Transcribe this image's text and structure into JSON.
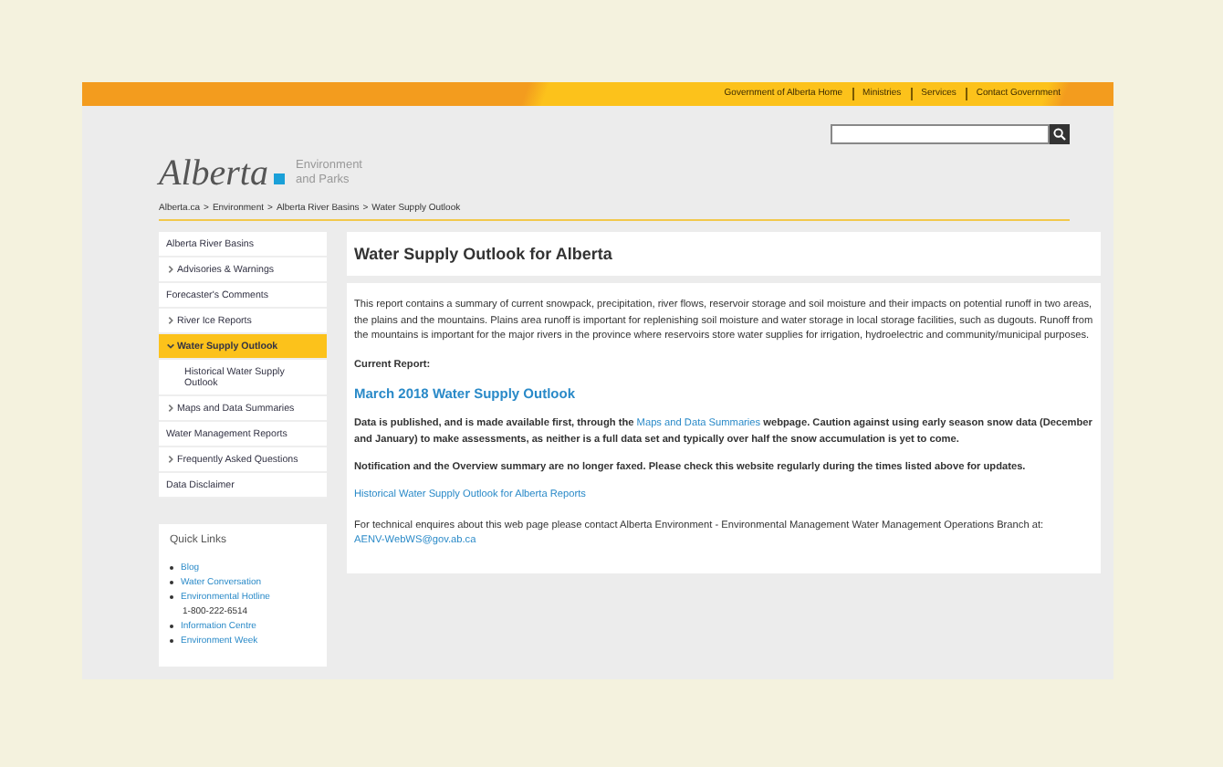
{
  "top_nav": [
    "Government of Alberta Home",
    "Ministries",
    "Services",
    "Contact Government"
  ],
  "logo": {
    "wordmark": "Alberta",
    "department": [
      "Environment",
      "and Parks"
    ]
  },
  "breadcrumb": {
    "separator": ">",
    "items": [
      "Alberta.ca",
      "Environment",
      "Alberta River Basins",
      "Water Supply Outlook"
    ]
  },
  "sidebar": {
    "items": [
      {
        "label": "Alberta River Basins",
        "kind": "plain",
        "selected": false
      },
      {
        "label": "Advisories & Warnings",
        "kind": "toggle",
        "expanded": false,
        "selected": false
      },
      {
        "label": "Forecaster's Comments",
        "kind": "plain",
        "selected": false
      },
      {
        "label": "River Ice Reports",
        "kind": "toggle",
        "expanded": false,
        "selected": false
      },
      {
        "label": "Water Supply Outlook",
        "kind": "toggle",
        "expanded": true,
        "selected": true,
        "children": [
          {
            "label": "Historical Water Supply Outlook",
            "selected": false
          }
        ]
      },
      {
        "label": "Maps and Data Summaries",
        "kind": "toggle",
        "expanded": false,
        "selected": false
      },
      {
        "label": "Water Management Reports",
        "kind": "plain",
        "selected": false
      },
      {
        "label": "Frequently Asked Questions",
        "kind": "toggle",
        "expanded": false,
        "selected": false
      },
      {
        "label": "Data Disclaimer",
        "kind": "plain",
        "selected": false
      }
    ]
  },
  "quick_links": {
    "title": "Quick Links",
    "items": [
      {
        "label": "Blog",
        "kind": "link"
      },
      {
        "label": "Water Conversation",
        "kind": "link"
      },
      {
        "label": "Environmental Hotline",
        "kind": "link"
      },
      {
        "label": "1-800-222-6514",
        "kind": "text"
      },
      {
        "label": "Information Centre",
        "kind": "link"
      },
      {
        "label": "Environment Week",
        "kind": "link"
      }
    ]
  },
  "content": {
    "title": "Water Supply Outlook for Alberta",
    "intro": "This report contains a summary of current snowpack, precipitation, river flows, reservoir storage and soil moisture and their impacts on potential runoff in two areas, the plains and the mountains. Plains area runoff is important for replenishing soil moisture and water storage in local storage facilities, such as dugouts. Runoff from the mountains is important for the major rivers in the province where reservoirs store water supplies for irrigation, hydroelectric and community/municipal purposes.",
    "current_label": "Current Report:",
    "report_link": "March 2018 Water Supply Outlook",
    "published": {
      "before": "Data is published, and is made available first, through the ",
      "link": "Maps and Data Summaries",
      "after": " webpage. Caution against using early season snow data (December and January) to make assessments, as neither is a full data set and typically over half the snow accumulation is yet to come."
    },
    "notification": "Notification and the Overview summary are no longer faxed. Please check this website regularly during the times listed above for updates.",
    "historical_link": "Historical Water Supply Outlook for Alberta Reports",
    "contact": {
      "before": "For technical enquires about this web page please contact Alberta Environment - Environmental Management Water Management Operations Branch at: ",
      "link": "AENV-WebWS@gov.ab.ca"
    }
  }
}
